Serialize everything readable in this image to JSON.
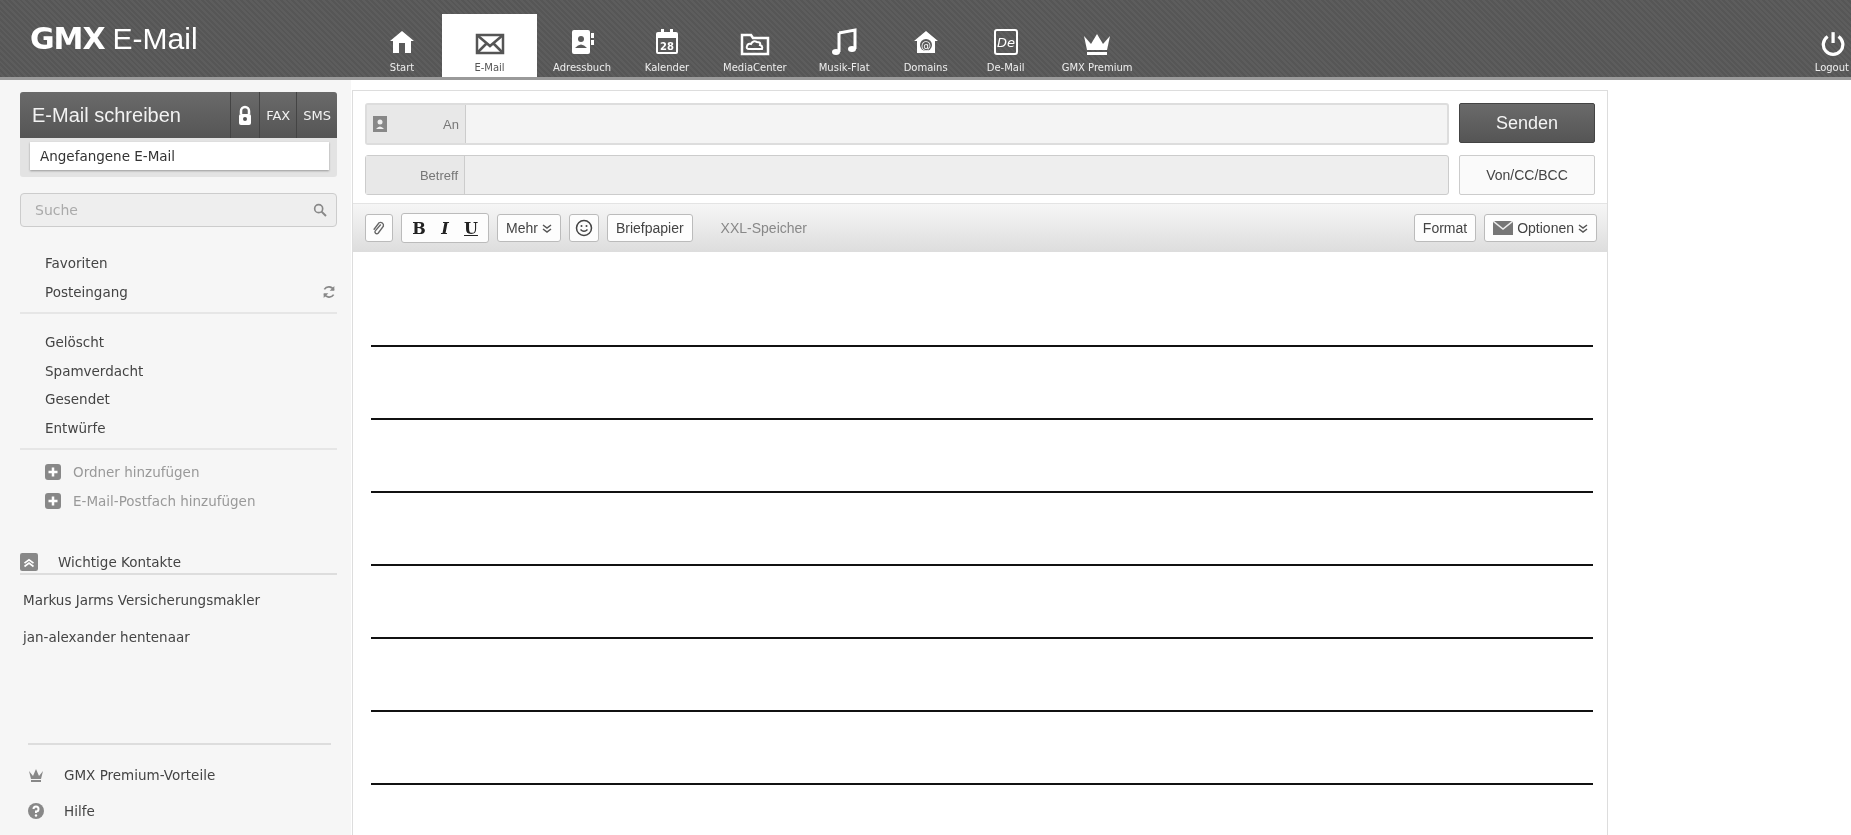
{
  "header": {
    "logo_brand": "GMX",
    "logo_product": "E-Mail",
    "nav": [
      {
        "kind": "home",
        "label": "Start",
        "selected": false
      },
      {
        "kind": "mail",
        "label": "E-Mail",
        "selected": true
      },
      {
        "kind": "contacts",
        "label": "Adressbuch",
        "selected": false
      },
      {
        "kind": "calendar",
        "icon_text": "28",
        "label": "Kalender",
        "selected": false
      },
      {
        "kind": "cloud",
        "label": "MediaCenter",
        "selected": false
      },
      {
        "kind": "music",
        "label": "Musik-Flat",
        "selected": false
      },
      {
        "kind": "domain",
        "icon_text": "@",
        "label": "Domains",
        "selected": false
      },
      {
        "kind": "demail",
        "icon_text": "De",
        "label": "De-Mail",
        "selected": false
      },
      {
        "kind": "crown",
        "label": "GMX Premium",
        "selected": false
      }
    ],
    "logout": {
      "label": "Logout"
    }
  },
  "sidebar": {
    "compose": {
      "label": "E-Mail schreiben",
      "fax": "FAX",
      "sms": "SMS"
    },
    "draft_menu": [
      "Angefangene E-Mail"
    ],
    "search": {
      "placeholder": "Suche"
    },
    "folder_groups": [
      [
        {
          "label": "Favoriten",
          "refresh": false
        },
        {
          "label": "Posteingang",
          "refresh": true
        }
      ],
      [
        {
          "label": "Gelöscht",
          "refresh": false
        },
        {
          "label": "Spamverdacht",
          "refresh": false
        },
        {
          "label": "Gesendet",
          "refresh": false
        },
        {
          "label": "Entwürfe",
          "refresh": false
        }
      ]
    ],
    "add_actions": [
      "Ordner hinzufügen",
      "E-Mail-Postfach hinzufügen"
    ],
    "contacts": {
      "title": "Wichtige Kontakte",
      "expanded": true,
      "items": [
        "Markus Jarms Versicherungsmakler",
        "jan-alexander hentenaar"
      ]
    },
    "footer": [
      {
        "kind": "premium",
        "label": "GMX Premium-Vorteile"
      },
      {
        "kind": "help",
        "label": "Hilfe"
      }
    ]
  },
  "compose": {
    "to": {
      "label": "An"
    },
    "subject": {
      "label": "Betreff"
    },
    "send": "Senden",
    "cc_toggle": "Von/CC/BCC",
    "toolbar": [
      {
        "kind": "attach"
      },
      {
        "kind": "style_group",
        "items": [
          "B",
          "I",
          "U"
        ]
      },
      {
        "kind": "dropdown",
        "label": "Mehr"
      },
      {
        "kind": "emoji"
      },
      {
        "kind": "button",
        "label": "Briefpapier"
      },
      {
        "kind": "note",
        "label": "XXL-Speicher"
      }
    ],
    "toolbar_right": [
      {
        "kind": "button",
        "label": "Format"
      },
      {
        "kind": "options",
        "label": "Optionen"
      }
    ],
    "ruled_lines": true
  }
}
